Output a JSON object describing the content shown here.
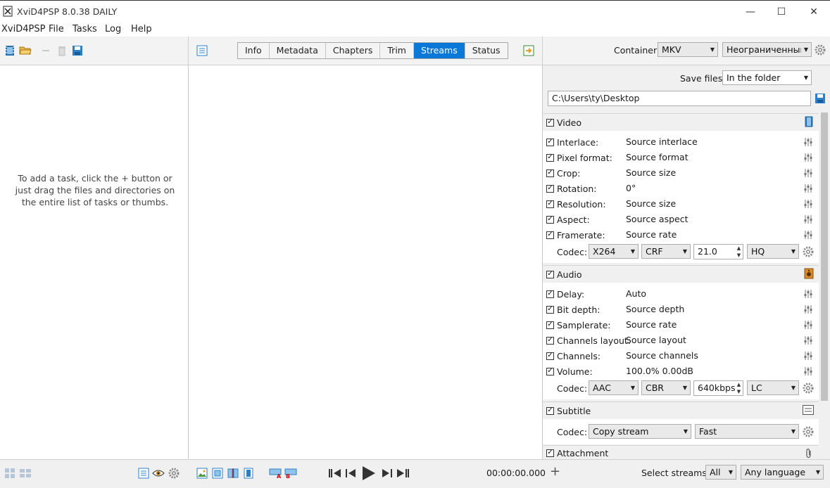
{
  "window": {
    "title": "XviD4PSP 8.0.38 DAILY",
    "minimize_glyph": "—",
    "maximize_glyph": "☐",
    "close_glyph": "✕"
  },
  "menu": [
    "XviD4PSP",
    "File",
    "Tasks",
    "Log",
    "Help"
  ],
  "tabs": [
    {
      "label": "Info",
      "active": false
    },
    {
      "label": "Metadata",
      "active": false
    },
    {
      "label": "Chapters",
      "active": false
    },
    {
      "label": "Trim",
      "active": false
    },
    {
      "label": "Streams",
      "active": true
    },
    {
      "label": "Status",
      "active": false
    }
  ],
  "container": {
    "label": "Container:",
    "value": "MKV",
    "limit": "Неограниченный"
  },
  "save": {
    "label": "Save files:",
    "value": "In the folder",
    "path": "C:\\Users\\ty\\Desktop"
  },
  "hint": "To add a task, click the + button or just drag the files and directories on the entire list of tasks or thumbs.",
  "video": {
    "title": "Video",
    "rows": [
      {
        "label": "Interlace:",
        "value": "Source interlace"
      },
      {
        "label": "Pixel format:",
        "value": "Source format"
      },
      {
        "label": "Crop:",
        "value": "Source size"
      },
      {
        "label": "Rotation:",
        "value": "0°"
      },
      {
        "label": "Resolution:",
        "value": "Source size"
      },
      {
        "label": "Aspect:",
        "value": "Source aspect"
      },
      {
        "label": "Framerate:",
        "value": "Source rate"
      }
    ],
    "codec_label": "Codec:",
    "codec": "X264",
    "mode": "CRF",
    "quality": "21.0",
    "preset": "HQ"
  },
  "audio": {
    "title": "Audio",
    "rows": [
      {
        "label": "Delay:",
        "value": "Auto"
      },
      {
        "label": "Bit depth:",
        "value": "Source depth"
      },
      {
        "label": "Samplerate:",
        "value": "Source rate"
      },
      {
        "label": "Channels layout:",
        "value": "Source layout"
      },
      {
        "label": "Channels:",
        "value": "Source channels"
      },
      {
        "label": "Volume:",
        "value": "100.0% 0.00dB"
      }
    ],
    "codec_label": "Codec:",
    "codec": "AAC",
    "mode": "CBR",
    "bitrate": "640kbps",
    "profile": "LC"
  },
  "subtitle": {
    "title": "Subtitle",
    "codec_label": "Codec:",
    "codec": "Copy stream",
    "speed": "Fast"
  },
  "attachment": {
    "title": "Attachment"
  },
  "bottom": {
    "time": "00:00:00.000",
    "add_glyph": "+",
    "select_label": "Select streams:",
    "select_value": "All",
    "language": "Any language"
  },
  "colors": {
    "accent": "#0a78d7"
  }
}
